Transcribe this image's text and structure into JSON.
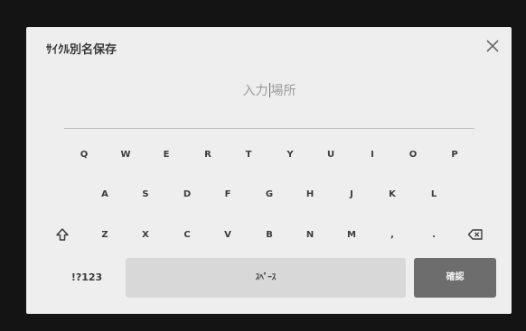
{
  "dialog": {
    "title": "ｻｲｸﾙ別名保存",
    "close_icon": "close-icon"
  },
  "input": {
    "placeholder_left": "入力",
    "placeholder_right": "場所"
  },
  "keyboard": {
    "row1": [
      "Q",
      "W",
      "E",
      "R",
      "T",
      "Y",
      "U",
      "I",
      "O",
      "P"
    ],
    "row2": [
      "A",
      "S",
      "D",
      "F",
      "G",
      "H",
      "J",
      "K",
      "L"
    ],
    "row3": [
      "Z",
      "X",
      "C",
      "V",
      "B",
      "N",
      "M",
      ",",
      "."
    ],
    "shift_icon": "shift-icon",
    "backspace_icon": "backspace-icon",
    "symbols_label": "!?123",
    "space_label": "ｽﾍﾟｰｽ",
    "confirm_label": "確認"
  }
}
